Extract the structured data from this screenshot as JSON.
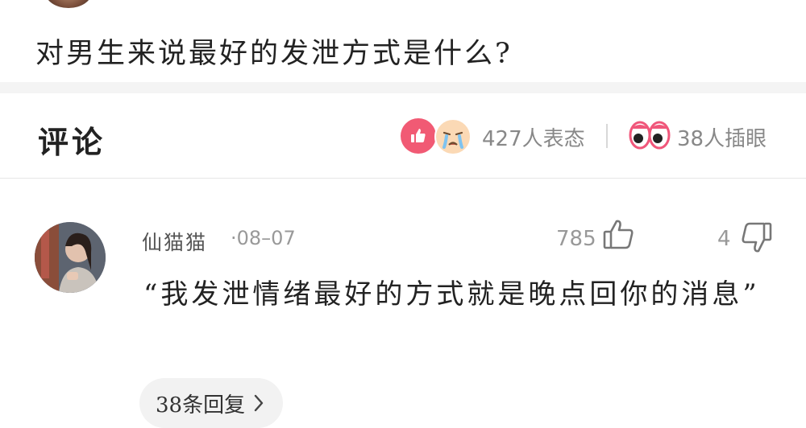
{
  "post": {
    "question": "对男生来说最好的发泄方式是什么?"
  },
  "comments_header": {
    "title": "评论",
    "reaction_text": "427人表态",
    "eyes_text": "38人插眼"
  },
  "comment": {
    "username": "仙猫猫",
    "date": "·08–07",
    "like_count": "785",
    "dislike_count": "4",
    "text": "“我发泄情绪最好的方式就是晚点回你的消息”",
    "reply_label": "38条回复"
  },
  "icons": {
    "like_badge": "thumbs-up-icon",
    "cry_badge": "crying-face-icon",
    "eyes_badge": "eyes-icon",
    "thumb_up": "thumb-up-outline-icon",
    "thumb_down": "thumb-down-outline-icon",
    "chevron": "chevron-right-icon"
  },
  "colors": {
    "like_badge": "#f15a74",
    "text_muted": "#888888",
    "divider": "#f4f4f4"
  }
}
